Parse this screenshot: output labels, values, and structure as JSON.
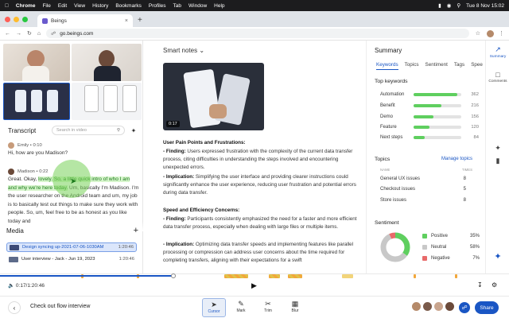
{
  "menubar": {
    "apple": "",
    "items": [
      "Chrome",
      "File",
      "Edit",
      "View",
      "History",
      "Bookmarks",
      "Profiles",
      "Tab",
      "Window",
      "Help"
    ],
    "clock": "Tue 8 Nov 15:02"
  },
  "browser": {
    "tab_title": "Beings",
    "url": "go.beings.com"
  },
  "transcript": {
    "title": "Transcript",
    "search_placeholder": "Search in video",
    "messages": [
      {
        "speaker": "Emily",
        "time": "0:10",
        "text": "Hi, how are you Madison?"
      },
      {
        "speaker": "Madison",
        "time": "0:22",
        "pre": "Great. Okay, ",
        "hl": "lovely. So, a little quick intro of who I am and why we're here today.",
        "post": " Um, basically I'm Madison. I'm the user researcher on the Android team and um, my job is to basically test out things to make sure they work with people. So, um, feel free to be as honest as you like today and"
      }
    ]
  },
  "media": {
    "title": "Media",
    "items": [
      {
        "name": "Design syncing up-2021-07-06-1030AM",
        "dur": "1:20:46"
      },
      {
        "name": "User interview - Jack - Jun 19, 2023",
        "dur": "1:20:46"
      }
    ]
  },
  "notes": {
    "title": "Smart notes",
    "video_time": "0:17",
    "heading1": "User Pain Points and Frustrations:",
    "f1_label": "- Finding:",
    "f1_text": " Users expressed frustration with the complexity of the current data transfer process, citing difficulties in understanding the steps involved and encountering unexpected errors.",
    "i1_label": "- Implication:",
    "i1_text": " Simplifying the user interface and providing clearer instructions could significantly enhance the user experience, reducing user frustration and potential errors during data transfer.",
    "heading2": "Speed and Efficiency Concerns:",
    "f2_label": "- Finding:",
    "f2_text": " Participants consistently emphasized the need for a faster and more efficient data transfer process, especially when dealing with large files or multiple items.",
    "i2_label": "- Implication:",
    "i2_text": " Optimizing data transfer speeds and implementing features like parallel processing or compression can address user concerns about the time required for completing transfers, aligning with their expectations for a swift"
  },
  "summary": {
    "title": "Summary",
    "tabs": [
      "Keywords",
      "Topics",
      "Sentiment",
      "Tags",
      "Spee"
    ],
    "top_keywords_title": "Top keywords",
    "keywords": [
      {
        "label": "Automation",
        "count": "362",
        "frac": 0.92
      },
      {
        "label": "Benefit",
        "count": "216",
        "frac": 0.58
      },
      {
        "label": "Demo",
        "count": "156",
        "frac": 0.42
      },
      {
        "label": "Feature",
        "count": "120",
        "frac": 0.33
      },
      {
        "label": "Next steps",
        "count": "84",
        "frac": 0.24
      }
    ],
    "topics_title": "Topics",
    "manage_topics": "Manage topics",
    "topic_col_name": "NAME",
    "topic_col_times": "TIMES",
    "topics": [
      {
        "name": "General UX issues",
        "times": "8"
      },
      {
        "name": "Checkout issues",
        "times": "5"
      },
      {
        "name": "Store issues",
        "times": "8"
      }
    ],
    "sentiment_title": "Sentiment",
    "sentiment": [
      {
        "label": "Positive",
        "value": "35%",
        "color": "#5fcf5f"
      },
      {
        "label": "Neutral",
        "value": "58%",
        "color": "#c8c8c8"
      },
      {
        "label": "Negative",
        "value": "7%",
        "color": "#e86a6a"
      }
    ]
  },
  "rail": {
    "summary": "Summary",
    "comments": "Comments"
  },
  "player": {
    "timecode": "0:17/1:20:46",
    "progress": 0.34
  },
  "bottom": {
    "flow_title": "Check out flow interview",
    "tools": [
      "Cursor",
      "Mark",
      "Trim",
      "Blur"
    ],
    "share": "Share"
  },
  "colors": {
    "accent": "#1a56c4",
    "positive": "#5fcf5f",
    "negative": "#e86a6a",
    "timeline_marker": "#f2a73b"
  }
}
